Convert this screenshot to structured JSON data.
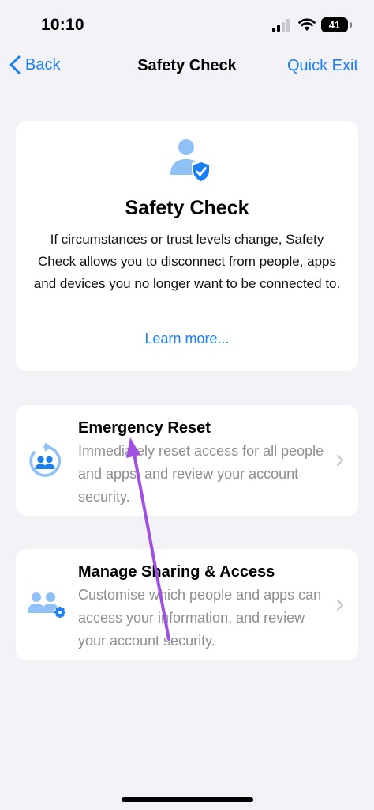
{
  "status_bar": {
    "time": "10:10",
    "battery": "41"
  },
  "nav": {
    "back_label": "Back",
    "title": "Safety Check",
    "quick_exit_label": "Quick Exit"
  },
  "hero": {
    "title": "Safety Check",
    "description": "If circumstances or trust levels change, Safety Check allows you to disconnect from people, apps and devices you no longer want to be connected to.",
    "learn_more": "Learn more..."
  },
  "options": [
    {
      "title": "Emergency Reset",
      "description": "Immediately reset access for all people and apps, and review your account security.",
      "icon": "emergency-reset-icon"
    },
    {
      "title": "Manage Sharing & Access",
      "description": "Customise which people and apps can access your information, and review your account security.",
      "icon": "manage-sharing-icon"
    }
  ],
  "colors": {
    "accent": "#1a7ff5",
    "icon_light": "#8fc1f7",
    "annotation_arrow": "#a050e0",
    "background": "#f2f2f7"
  }
}
